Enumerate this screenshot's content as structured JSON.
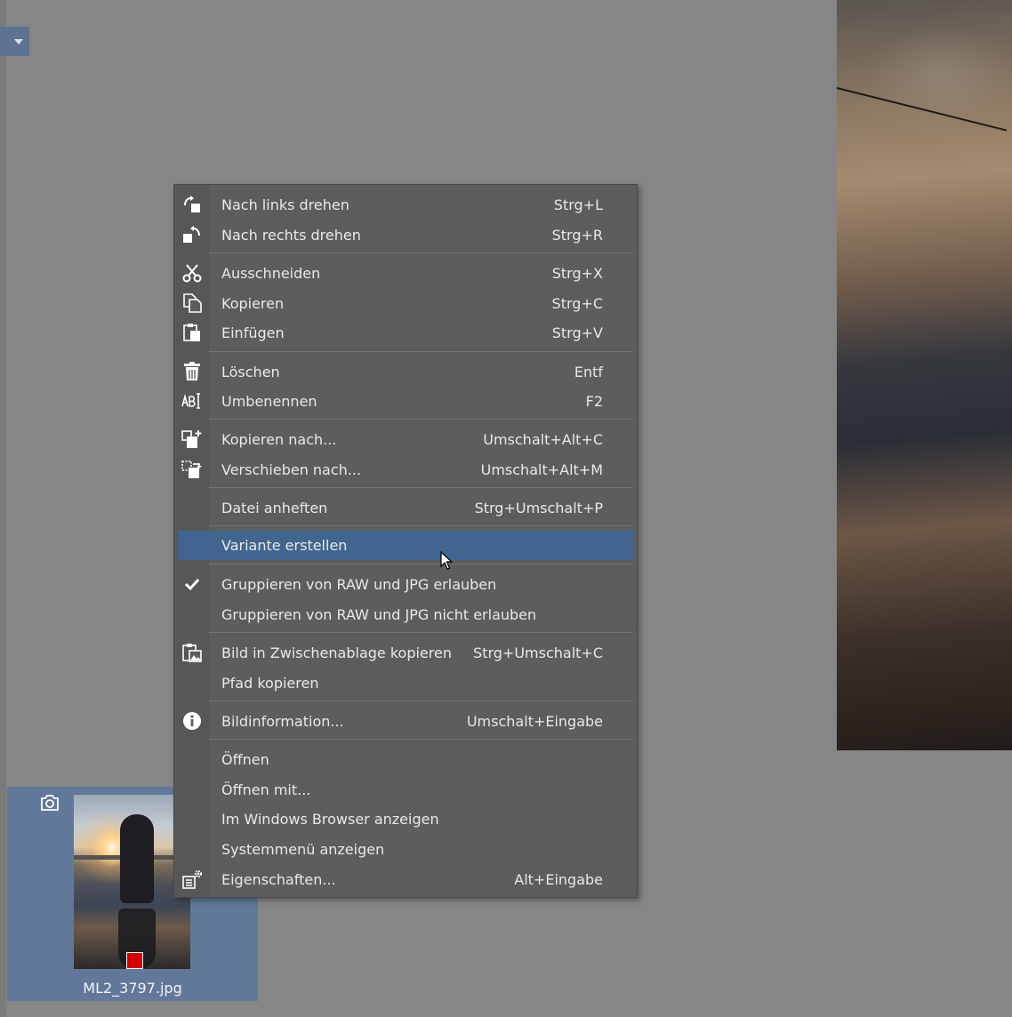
{
  "thumbnail": {
    "filename": "ML2_3797.jpg",
    "label_color": "#d40000"
  },
  "colors": {
    "menu_bg": "#5d5d5d",
    "highlight": "#42658f",
    "selection_tile": "#62789a"
  },
  "menu": {
    "items": [
      {
        "label": "Nach links drehen",
        "shortcut": "Strg+L",
        "icon": "rotate-left-icon"
      },
      {
        "label": "Nach rechts drehen",
        "shortcut": "Strg+R",
        "icon": "rotate-right-icon"
      },
      {
        "label": "Ausschneiden",
        "shortcut": "Strg+X",
        "icon": "scissors-icon"
      },
      {
        "label": "Kopieren",
        "shortcut": "Strg+C",
        "icon": "copy-icon"
      },
      {
        "label": "Einfügen",
        "shortcut": "Strg+V",
        "icon": "paste-icon"
      },
      {
        "label": "Löschen",
        "shortcut": "Entf",
        "icon": "trash-icon"
      },
      {
        "label": "Umbenennen",
        "shortcut": "F2",
        "icon": "rename-icon"
      },
      {
        "label": "Kopieren nach...",
        "shortcut": "Umschalt+Alt+C",
        "icon": "copy-to-icon"
      },
      {
        "label": "Verschieben nach...",
        "shortcut": "Umschalt+Alt+M",
        "icon": "move-to-icon"
      },
      {
        "label": "Datei anheften",
        "shortcut": "Strg+Umschalt+P",
        "icon": ""
      },
      {
        "label": "Variante erstellen",
        "shortcut": "",
        "icon": "",
        "highlighted": true
      },
      {
        "label": "Gruppieren von RAW und JPG erlauben",
        "shortcut": "",
        "icon": "checkmark-icon",
        "checked": true
      },
      {
        "label": "Gruppieren von RAW und JPG nicht erlauben",
        "shortcut": "",
        "icon": ""
      },
      {
        "label": "Bild in Zwischenablage kopieren",
        "shortcut": "Strg+Umschalt+C",
        "icon": "clipboard-image-icon"
      },
      {
        "label": "Pfad kopieren",
        "shortcut": "",
        "icon": ""
      },
      {
        "label": "Bildinformation...",
        "shortcut": "Umschalt+Eingabe",
        "icon": "info-icon"
      },
      {
        "label": "Öffnen",
        "shortcut": "",
        "icon": ""
      },
      {
        "label": "Öffnen mit...",
        "shortcut": "",
        "icon": ""
      },
      {
        "label": "Im Windows Browser anzeigen",
        "shortcut": "",
        "icon": ""
      },
      {
        "label": "Systemmenü anzeigen",
        "shortcut": "",
        "icon": ""
      },
      {
        "label": "Eigenschaften...",
        "shortcut": "Alt+Eingabe",
        "icon": "properties-icon"
      }
    ]
  }
}
